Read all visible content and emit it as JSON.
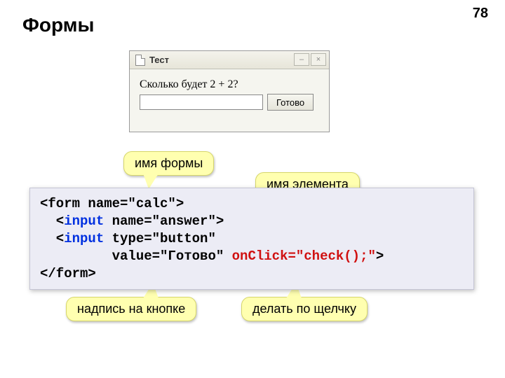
{
  "page_number": "78",
  "title": "Формы",
  "window": {
    "title": "Тест",
    "prompt_text": "Сколько будет 2 + 2?",
    "button_label": "Готово",
    "minimize_glyph": "–",
    "close_glyph": "×"
  },
  "callouts": {
    "form_name": "имя формы",
    "element_name": "имя элемента",
    "button_caption": "надпись на кнопке",
    "on_click": "делать по щелчку"
  },
  "code": {
    "l1_a": "<form name=\"calc\">",
    "l2_a": "  <",
    "l2_b": "input",
    "l2_c": " name=\"answer\">",
    "l3_a": "  <",
    "l3_b": "input",
    "l3_c": " type=\"button\"",
    "l4_a": "         value=\"Готово\" ",
    "l4_b": "onClick=\"check();\"",
    "l4_c": ">",
    "l5_a": "</form>"
  }
}
